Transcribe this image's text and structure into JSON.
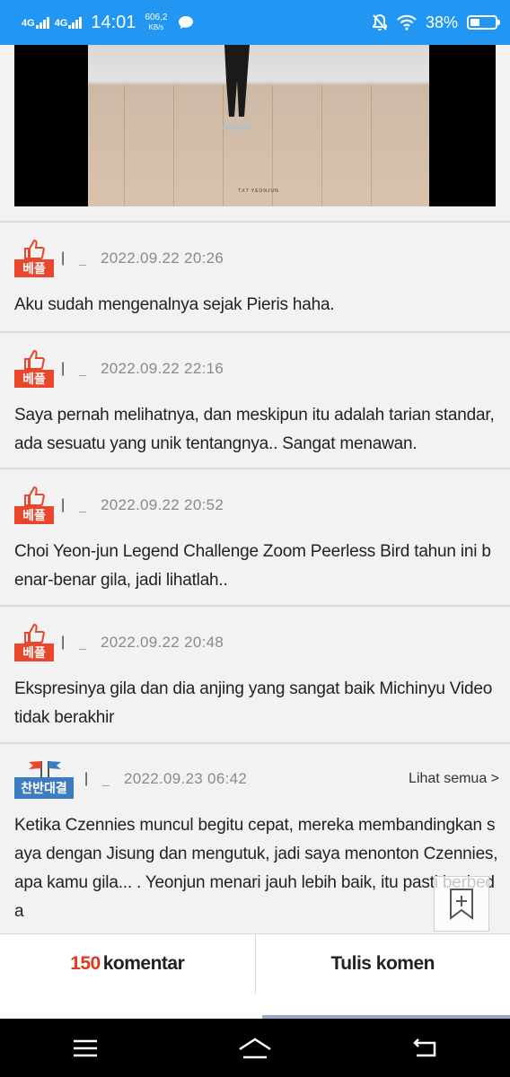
{
  "status_bar": {
    "network_1": "4G",
    "network_2": "4G",
    "time": "14:01",
    "speed_value": "606,2",
    "speed_unit": "KB/s",
    "battery": "38%",
    "battery_level": 0.38,
    "icons": [
      "chat-bubble-icon",
      "mute-bell-icon",
      "wifi-icon",
      "battery-icon"
    ]
  },
  "video": {
    "caption": "TXT YEONJUN"
  },
  "comments": [
    {
      "badge": "베플",
      "separator": "|",
      "author": "_",
      "date": "2022.09.22 20:26",
      "text": "Aku sudah mengenalnya sejak Pieris haha."
    },
    {
      "badge": "베플",
      "separator": "|",
      "author": "_",
      "date": "2022.09.22 22:16",
      "text": "Saya pernah melihatnya, dan meskipun itu adalah tarian standar, ada sesuatu yang unik tentangnya.. Sangat menawan."
    },
    {
      "badge": "베플",
      "separator": "|",
      "author": "_",
      "date": "2022.09.22 20:52",
      "text": "Choi Yeon-jun Legend Challenge Zoom Peerless Bird tahun ini benar-benar gila, jadi lihatlah.."
    },
    {
      "badge": "베플",
      "separator": "|",
      "author": "_",
      "date": "2022.09.22 20:48",
      "text": "Ekspresinya gila dan dia anjing yang sangat baik Michinyu Video tidak berakhir"
    },
    {
      "badge": "찬반대결",
      "separator": "|",
      "author": "_",
      "date": "2022.09.23 06:42",
      "see_all": "Lihat semua >",
      "text": "Ketika Czennies muncul begitu cepat, mereka membandingkan saya dengan Jisung dan mengutuk, jadi saya menonton Czennies, apa kamu gila... . Yeonjun menari jauh lebih baik, itu pasti berbeda"
    }
  ],
  "comment_bar": {
    "count": "150",
    "count_label": "komentar",
    "write_label": "Tulis komen"
  },
  "floating": {
    "bookmark_icon": "bookmark-add-icon",
    "top_icon": "arrow-up-icon"
  },
  "nav": {
    "icons": [
      "menu-icon",
      "home-icon",
      "back-icon"
    ]
  },
  "colors": {
    "status_bar": "#2196f3",
    "best_badge": "#e9472c",
    "versus_badge": "#3d7cc0",
    "count": "#e0391f"
  }
}
